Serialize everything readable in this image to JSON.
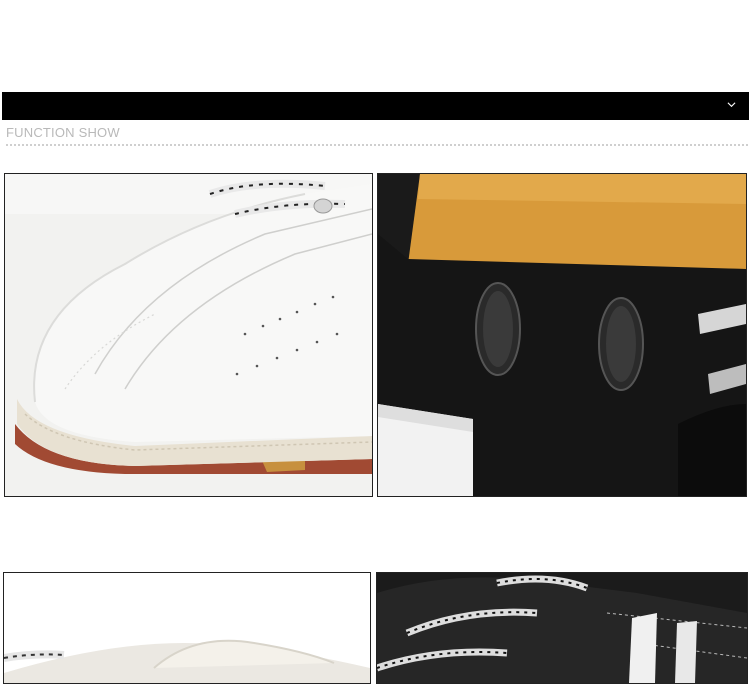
{
  "section": {
    "title": "FUNCTION SHOW"
  },
  "icons": {
    "header_toggle": "chevron-down-icon"
  },
  "colors": {
    "header_bar": "#000000",
    "title_text": "#b9b9b9"
  }
}
